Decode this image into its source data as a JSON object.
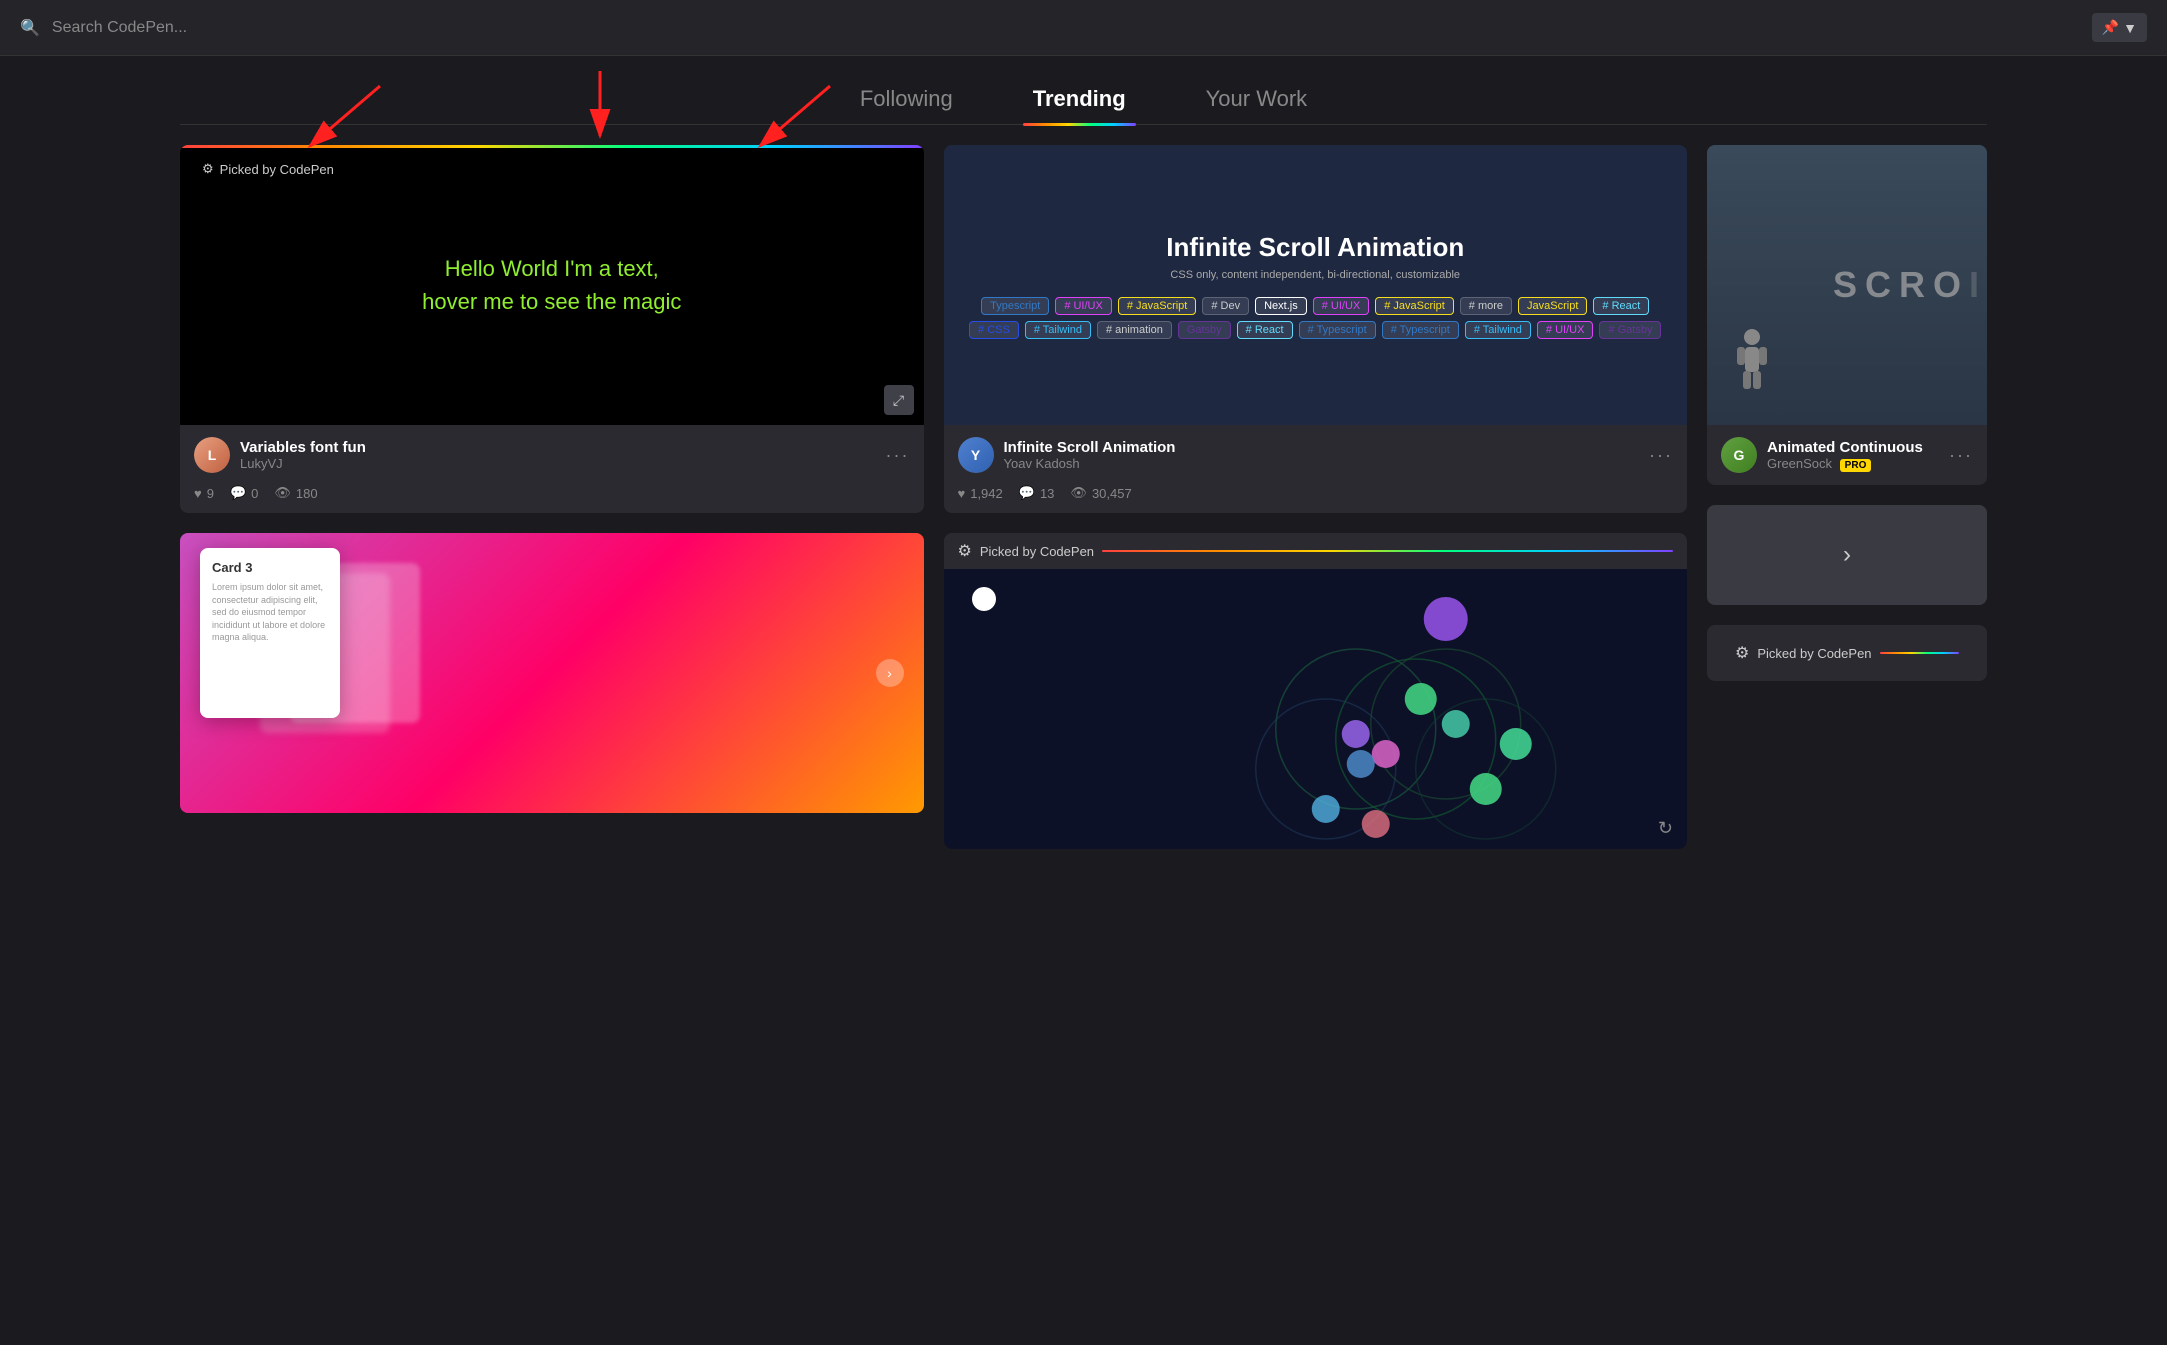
{
  "header": {
    "search_placeholder": "Search CodePen...",
    "pin_label": "▼"
  },
  "tabs": {
    "following": "Following",
    "trending": "Trending",
    "your_work": "Your Work",
    "active": "trending"
  },
  "cards": [
    {
      "id": "card1",
      "title": "Variables font fun",
      "author": "LukyVJ",
      "preview_text_line1": "Hello World I'm a text,",
      "preview_text_line2": "hover me to see the magic",
      "picked": true,
      "picked_label": "Picked by CodePen",
      "stats": {
        "hearts": "9",
        "comments": "0",
        "views": "180"
      }
    },
    {
      "id": "card2",
      "title": "Infinite Scroll Animation",
      "author": "Yoav Kadosh",
      "picked": false,
      "preview_title": "Infinite Scroll Animation",
      "preview_sub": "CSS only, content independent, bi-directional, customizable",
      "tags": [
        "Typescript",
        "# UI/UX",
        "# JavaScript",
        "# Dev",
        "Next.js",
        "# UI/UX",
        "# JavaScript",
        "# more",
        "JavaScript",
        "# React",
        "# CSS",
        "# Tailwind",
        "# animation",
        "Gatsby",
        "# React",
        "# Typescript",
        "# Typescript",
        "# Tailwind",
        "# UI/UX",
        "# Gatsby"
      ],
      "stats": {
        "hearts": "1,942",
        "comments": "13",
        "views": "30,457"
      }
    },
    {
      "id": "card3",
      "title": "Card 3",
      "card_text": "Lorem ipsum dolor sit amet, consectetur adipiscing elit, sed do eiusmod tempor incididunt ut labore et dolore magna aliqua.",
      "author_placeholder": ""
    },
    {
      "id": "card4",
      "title": "Animated Continuous",
      "author": "GreenSock",
      "pro": true,
      "picked2_label": "Picked by CodePen"
    }
  ],
  "circles_card": {
    "picked_label": "Picked by CodePen",
    "refresh_icon": "↻"
  },
  "next_button_label": "›",
  "icons": {
    "search": "🔍",
    "pin": "📌",
    "heart": "♥",
    "comment": "💬",
    "view": "👁",
    "fullscreen": "⤢",
    "more": "···",
    "gear": "⚙"
  }
}
